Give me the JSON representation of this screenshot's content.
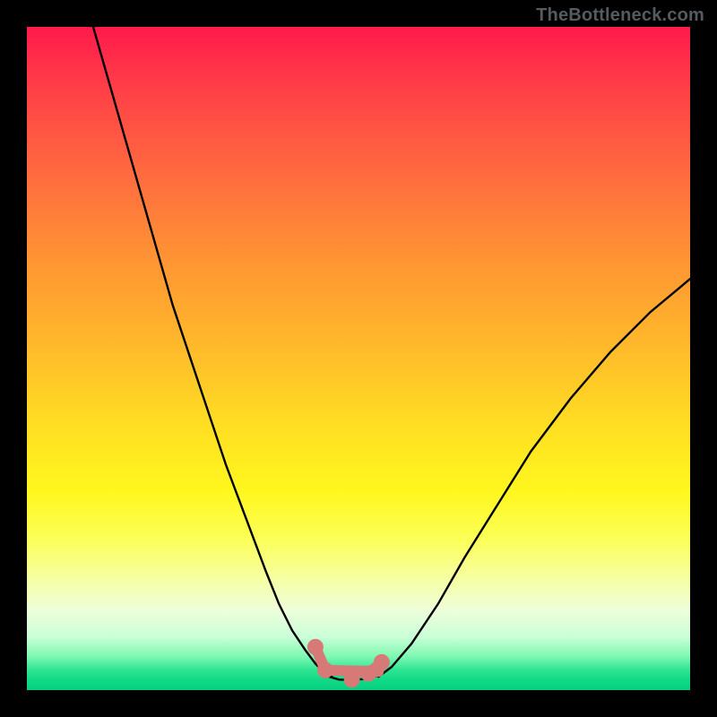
{
  "branding": {
    "watermark": "TheBottleneck.com"
  },
  "colors": {
    "background": "#000000",
    "gradient_top": "#ff1a4b",
    "gradient_mid": "#ffde22",
    "gradient_bottom": "#06d07f",
    "curve": "#000000",
    "marker": "#d77a77"
  },
  "chart_data": {
    "type": "line",
    "title": "",
    "xlabel": "",
    "ylabel": "",
    "xlim": [
      0,
      100
    ],
    "ylim": [
      0,
      100
    ],
    "grid": false,
    "legend": false,
    "series": [
      {
        "name": "left-curve",
        "x": [
          10,
          14,
          18,
          22,
          26,
          30,
          33,
          36,
          38,
          40,
          42,
          43.5,
          45,
          46
        ],
        "y": [
          100,
          86,
          72,
          58,
          46,
          34,
          26,
          18,
          13,
          9,
          6,
          4,
          2.5,
          2
        ]
      },
      {
        "name": "right-curve",
        "x": [
          53,
          55,
          58,
          62,
          66,
          71,
          76,
          82,
          88,
          94,
          100
        ],
        "y": [
          2,
          3.5,
          7,
          13,
          20,
          28,
          36,
          44,
          51,
          57,
          62
        ]
      },
      {
        "name": "valley-floor",
        "x": [
          45,
          47,
          49,
          51,
          53
        ],
        "y": [
          2.2,
          1.6,
          1.5,
          1.7,
          2.2
        ]
      }
    ],
    "markers": [
      {
        "name": "left-marker-high",
        "x": 43.5,
        "y": 6.5
      },
      {
        "name": "left-marker-low",
        "x": 45.0,
        "y": 3.0
      },
      {
        "name": "right-marker-low",
        "x": 51.5,
        "y": 2.5
      },
      {
        "name": "right-marker-high",
        "x": 53.5,
        "y": 4.2
      },
      {
        "name": "bottom-marker",
        "x": 49.0,
        "y": 1.6
      }
    ],
    "marker_segments": [
      {
        "from": [
          45.0,
          3.0
        ],
        "to": [
          53.0,
          2.8
        ]
      },
      {
        "from": [
          43.5,
          6.5
        ],
        "to": [
          45.0,
          3.0
        ]
      },
      {
        "from": [
          51.5,
          2.5
        ],
        "to": [
          53.5,
          4.2
        ]
      }
    ]
  }
}
